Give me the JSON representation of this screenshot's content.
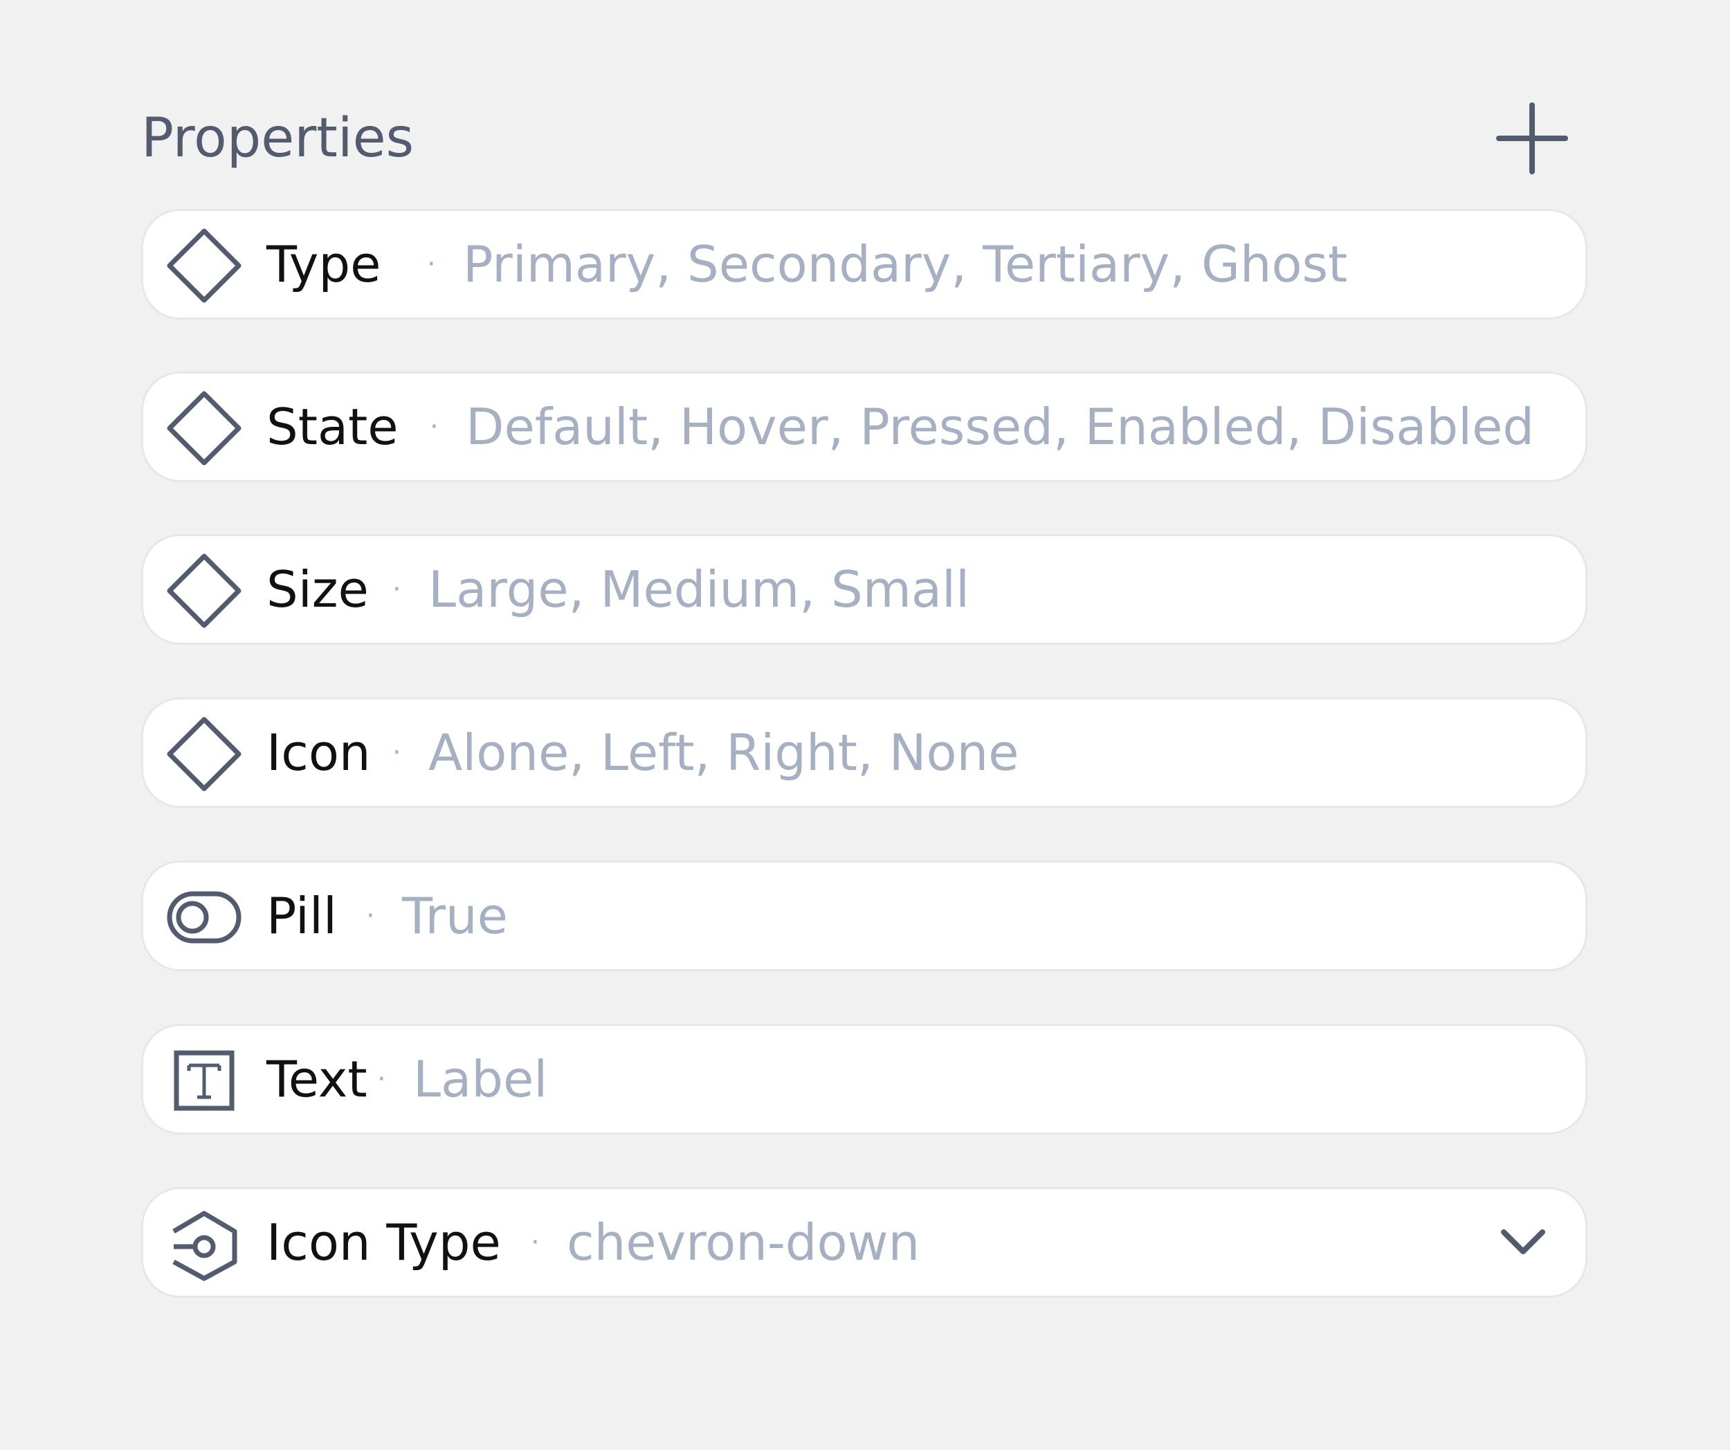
{
  "panel": {
    "title": "Properties",
    "add_icon": "plus-icon"
  },
  "rows": [
    {
      "name": "Type",
      "separator": "·",
      "values": "Primary, Secondary, Tertiary, Ghost",
      "icon": "variant-diamond-icon"
    },
    {
      "name": "State",
      "separator": "·",
      "values": "Default, Hover, Pressed, Enabled, Disabled",
      "icon": "variant-diamond-icon"
    },
    {
      "name": "Size",
      "separator": "·",
      "values": "Large, Medium, Small",
      "icon": "variant-diamond-icon"
    },
    {
      "name": "Icon",
      "separator": "·",
      "values": "Alone, Left, Right, None",
      "icon": "variant-diamond-icon"
    },
    {
      "name": "Pill",
      "separator": "·",
      "values": "True",
      "icon": "toggle-icon"
    },
    {
      "name": "Text",
      "separator": "·",
      "values": "Label",
      "icon": "text-icon"
    },
    {
      "name": "Icon Type",
      "separator": "·",
      "values": "chevron-down",
      "icon": "instance-swap-icon",
      "dropdown_icon": "chevron-down-icon"
    }
  ],
  "colors": {
    "background": "#f1f1f1",
    "row_background": "#ffffff",
    "row_border": "#e7e7e7",
    "icon_stroke": "#535b6e",
    "name_text": "#111111",
    "value_text": "#a6b0c3"
  }
}
